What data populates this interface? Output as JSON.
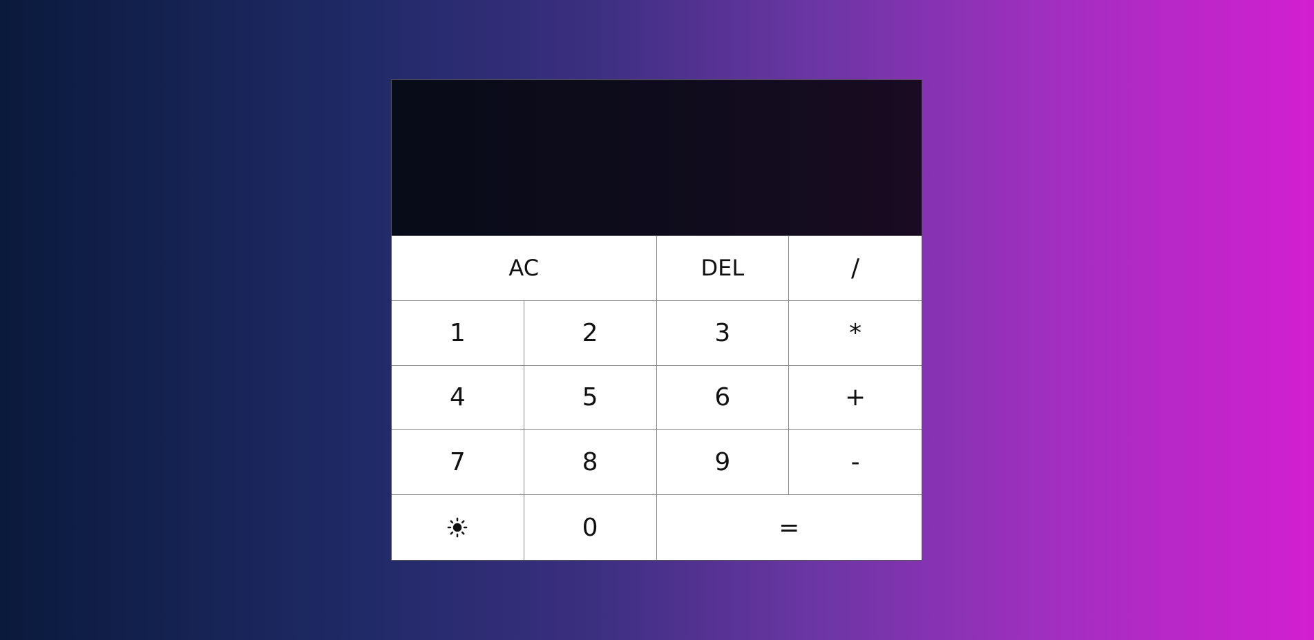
{
  "display": {
    "previous_operand": "",
    "current_operand": ""
  },
  "keys": {
    "ac": "AC",
    "del": "DEL",
    "divide": "/",
    "one": "1",
    "two": "2",
    "three": "3",
    "multiply": "*",
    "four": "4",
    "five": "5",
    "six": "6",
    "add": "+",
    "seven": "7",
    "eight": "8",
    "nine": "9",
    "subtract": "-",
    "theme_icon": "sun-icon",
    "zero": "0",
    "equals": "="
  }
}
